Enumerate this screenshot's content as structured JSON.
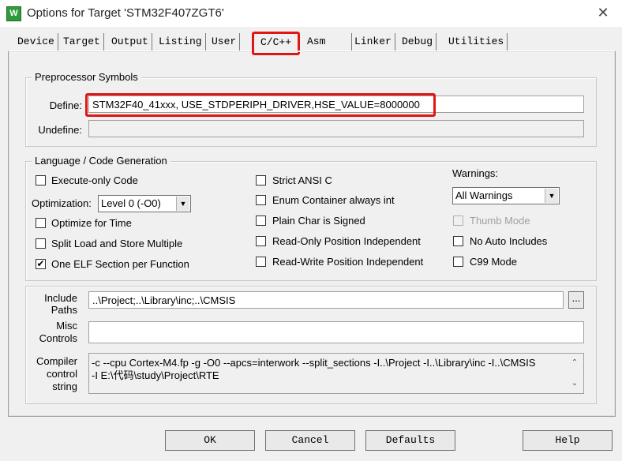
{
  "window": {
    "title": "Options for Target 'STM32F407ZGT6'",
    "icon_letter": "W",
    "close_glyph": "✕"
  },
  "tabs": [
    {
      "label": "Device"
    },
    {
      "label": "Target"
    },
    {
      "label": "Output"
    },
    {
      "label": "Listing"
    },
    {
      "label": "User"
    },
    {
      "label": "C/C++",
      "active": true
    },
    {
      "label": "Asm"
    },
    {
      "label": "Linker"
    },
    {
      "label": "Debug"
    },
    {
      "label": "Utilities"
    }
  ],
  "preprocessor": {
    "legend": "Preprocessor Symbols",
    "define_label": "Define:",
    "define_value": "STM32F40_41xxx, USE_STDPERIPH_DRIVER,HSE_VALUE=8000000",
    "undefine_label": "Undefine:",
    "undefine_value": ""
  },
  "language": {
    "legend": "Language / Code Generation",
    "execute_only": {
      "label": "Execute-only Code",
      "checked": false
    },
    "optimization_label": "Optimization:",
    "optimization_value": "Level 0 (-O0)",
    "optimize_time": {
      "label": "Optimize for Time",
      "checked": false
    },
    "split_load": {
      "label": "Split Load and Store Multiple",
      "checked": false
    },
    "one_elf": {
      "label": "One ELF Section per Function",
      "checked": true,
      "mark": "✔"
    },
    "strict_ansi": {
      "label": "Strict ANSI C",
      "checked": false
    },
    "enum_container": {
      "label": "Enum Container always int",
      "checked": false
    },
    "plain_char": {
      "label": "Plain Char is Signed",
      "checked": false
    },
    "ro_pos": {
      "label": "Read-Only Position Independent",
      "checked": false
    },
    "rw_pos": {
      "label": "Read-Write Position Independent",
      "checked": false
    },
    "warnings_label": "Warnings:",
    "warnings_value": "All Warnings",
    "thumb_mode": {
      "label": "Thumb Mode",
      "checked": false,
      "disabled": true
    },
    "no_auto_includes": {
      "label": "No Auto Includes",
      "checked": false
    },
    "c99_mode": {
      "label": "C99 Mode",
      "checked": false
    }
  },
  "paths": {
    "include_label_1": "Include",
    "include_label_2": "Paths",
    "include_value": "..\\Project;..\\Library\\inc;..\\CMSIS",
    "browse_label": "...",
    "misc_label_1": "Misc",
    "misc_label_2": "Controls",
    "misc_value": "",
    "compiler_label_1": "Compiler",
    "compiler_label_2": "control",
    "compiler_label_3": "string",
    "compiler_line_1": "-c --cpu Cortex-M4.fp -g -O0 --apcs=interwork --split_sections -I..\\Project -I..\\Library\\inc -I..\\CMSIS",
    "compiler_line_2": "-I E:\\代码\\study\\Project\\RTE"
  },
  "buttons": {
    "ok": "OK",
    "cancel": "Cancel",
    "defaults": "Defaults",
    "help": "Help"
  },
  "icons": [
    "app-icon",
    "close-icon",
    "chevron-down-icon",
    "scroll-up-icon",
    "scroll-down-icon",
    "check-icon"
  ],
  "colors": {
    "highlight": "#e01616",
    "dialog_bg": "#f0f0f0"
  }
}
